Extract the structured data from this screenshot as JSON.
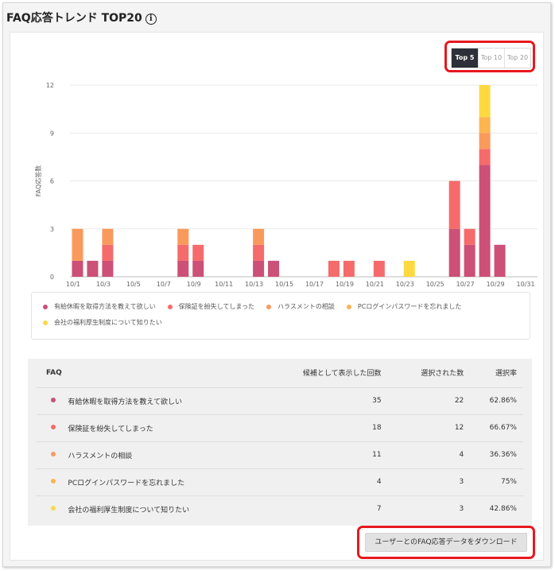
{
  "header": {
    "title": "FAQ応答トレンド TOP20",
    "info_icon": "info-icon"
  },
  "toggle": {
    "options": [
      "Top 5",
      "Top 10",
      "Top 20"
    ],
    "active": "Top 5"
  },
  "colors": {
    "series1": "#cc5077",
    "series2": "#f56b6b",
    "series3": "#f99a5c",
    "series4": "#fdb550",
    "series5": "#fdd941"
  },
  "chart_data": {
    "type": "bar",
    "stacked": true,
    "ylabel": "FAQ応答数",
    "ylim": [
      0,
      12
    ],
    "yticks": [
      0,
      3,
      6,
      9,
      12
    ],
    "grid": true,
    "legend_position": "bottom",
    "categories": [
      "10/1",
      "10/2",
      "10/3",
      "10/4",
      "10/5",
      "10/6",
      "10/7",
      "10/8",
      "10/9",
      "10/10",
      "10/11",
      "10/12",
      "10/13",
      "10/14",
      "10/15",
      "10/16",
      "10/17",
      "10/18",
      "10/19",
      "10/20",
      "10/21",
      "10/22",
      "10/23",
      "10/24",
      "10/25",
      "10/26",
      "10/27",
      "10/28",
      "10/29",
      "10/30",
      "10/31"
    ],
    "tick_labels": [
      "10/1",
      "10/3",
      "10/5",
      "10/7",
      "10/9",
      "10/11",
      "10/13",
      "10/15",
      "10/17",
      "10/19",
      "10/21",
      "10/23",
      "10/25",
      "10/27",
      "10/29",
      "10/31"
    ],
    "series": [
      {
        "name": "有給休暇を取得方法を教えて欲しい",
        "color": "#cc5077",
        "values": [
          1,
          1,
          1,
          0,
          0,
          0,
          0,
          1,
          1,
          0,
          0,
          0,
          1,
          1,
          0,
          0,
          0,
          0,
          0,
          0,
          0,
          0,
          0,
          0,
          0,
          3,
          2,
          7,
          2,
          0,
          0
        ]
      },
      {
        "name": "保険証を紛失してしまった",
        "color": "#f56b6b",
        "values": [
          0,
          0,
          1,
          0,
          0,
          0,
          0,
          1,
          1,
          0,
          0,
          0,
          1,
          0,
          0,
          0,
          0,
          1,
          1,
          0,
          1,
          0,
          0,
          0,
          0,
          3,
          1,
          1,
          0,
          0,
          0
        ]
      },
      {
        "name": "ハラスメントの相談",
        "color": "#f99a5c",
        "values": [
          2,
          0,
          1,
          0,
          0,
          0,
          0,
          1,
          0,
          0,
          0,
          0,
          1,
          0,
          0,
          0,
          0,
          0,
          0,
          0,
          0,
          0,
          0,
          0,
          0,
          0,
          0,
          1,
          0,
          0,
          0
        ]
      },
      {
        "name": "PCログインパスワードを忘れました",
        "color": "#fdb550",
        "values": [
          0,
          0,
          0,
          0,
          0,
          0,
          0,
          0,
          0,
          0,
          0,
          0,
          0,
          0,
          0,
          0,
          0,
          0,
          0,
          0,
          0,
          0,
          0,
          0,
          0,
          0,
          0,
          1,
          0,
          0,
          0
        ]
      },
      {
        "name": "会社の福利厚生制度について知りたい",
        "color": "#fdd941",
        "values": [
          0,
          0,
          0,
          0,
          0,
          0,
          0,
          0,
          0,
          0,
          0,
          0,
          0,
          0,
          0,
          0,
          0,
          0,
          0,
          0,
          0,
          0,
          1,
          0,
          0,
          0,
          0,
          2,
          0,
          0,
          0
        ]
      }
    ],
    "date_index_note_removed": true
  },
  "legend": [
    {
      "label": "有給休暇を取得方法を教えて欲しい",
      "color": "#cc5077"
    },
    {
      "label": "保険証を紛失してしまった",
      "color": "#f56b6b"
    },
    {
      "label": "ハラスメントの相談",
      "color": "#f99a5c"
    },
    {
      "label": "PCログインパスワードを忘れました",
      "color": "#fdb550"
    },
    {
      "label": "会社の福利厚生制度について知りたい",
      "color": "#fdd941"
    }
  ],
  "table": {
    "headers": {
      "faq": "FAQ",
      "shown": "候補として表示した回数",
      "selected": "選択された数",
      "rate": "選択率"
    },
    "rows": [
      {
        "name": "有給休暇を取得方法を教えて欲しい",
        "color": "#cc5077",
        "shown": "35",
        "selected": "22",
        "rate": "62.86%"
      },
      {
        "name": "保険証を紛失してしまった",
        "color": "#f56b6b",
        "shown": "18",
        "selected": "12",
        "rate": "66.67%"
      },
      {
        "name": "ハラスメントの相談",
        "color": "#f99a5c",
        "shown": "11",
        "selected": "4",
        "rate": "36.36%"
      },
      {
        "name": "PCログインパスワードを忘れました",
        "color": "#fdb550",
        "shown": "4",
        "selected": "3",
        "rate": "75%"
      },
      {
        "name": "会社の福利厚生制度について知りたい",
        "color": "#fdd941",
        "shown": "7",
        "selected": "3",
        "rate": "42.86%"
      }
    ]
  },
  "download": {
    "label": "ユーザーとのFAQ応答データをダウンロード"
  }
}
